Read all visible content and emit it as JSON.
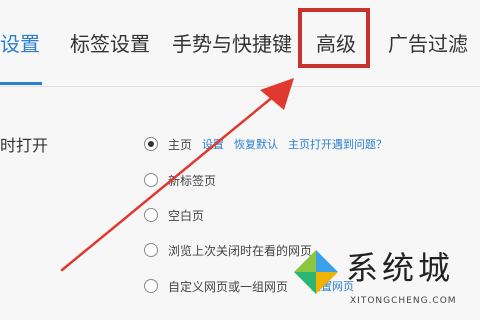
{
  "tabs": [
    {
      "label": "设置",
      "active": true
    },
    {
      "label": "标签设置",
      "active": false
    },
    {
      "label": "手势与快捷键",
      "active": false
    },
    {
      "label": "高级",
      "active": false,
      "highlighted": true
    },
    {
      "label": "广告过滤",
      "active": false
    }
  ],
  "startup": {
    "section_label": "时打开",
    "options": [
      {
        "label": "主页",
        "checked": true
      },
      {
        "label": "新标签页",
        "checked": false
      },
      {
        "label": "空白页",
        "checked": false
      },
      {
        "label": "浏览上次关闭时在看的网页",
        "checked": false
      },
      {
        "label": "自定义网页或一组网页",
        "checked": false
      }
    ],
    "homepage_links": [
      "设置",
      "恢复默认",
      "主页打开遇到问题？"
    ],
    "custom_link": "设置网页"
  },
  "watermark": {
    "name": "系统城",
    "url": "XITONGCHENG.COM"
  },
  "colors": {
    "accent": "#2a7fd0",
    "highlight": "#c8312d",
    "arrow": "#e0392f"
  }
}
